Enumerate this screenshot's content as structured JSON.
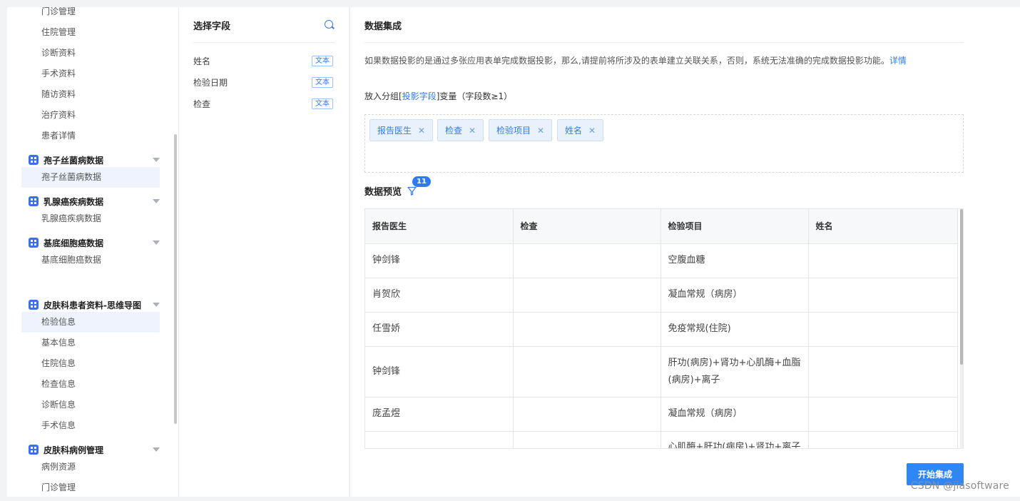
{
  "sidebar": {
    "top_items": [
      "门诊管理",
      "住院管理",
      "诊断资料",
      "手术资料",
      "随访资料",
      "治疗资料",
      "患者详情"
    ],
    "groups": [
      {
        "label": "孢子丝菌病数据",
        "items": [
          "孢子丝菌病数据"
        ]
      },
      {
        "label": "乳腺癌疾病数据",
        "items": [
          "乳腺癌疾病数据"
        ]
      },
      {
        "label": "基底细胞癌数据",
        "items": [
          "基底细胞癌数据"
        ]
      },
      {
        "label": "皮肤科患者资料-思维导图",
        "items": [
          "检验信息",
          "基本信息",
          "住院信息",
          "检查信息",
          "诊断信息",
          "手术信息"
        ]
      },
      {
        "label": "皮肤科病例管理",
        "items": [
          "病例资源",
          "门诊管理"
        ]
      }
    ]
  },
  "fields_panel": {
    "title": "选择字段",
    "fields": [
      {
        "name": "姓名",
        "type": "文本"
      },
      {
        "name": "检验日期",
        "type": "文本"
      },
      {
        "name": "检查",
        "type": "文本"
      }
    ]
  },
  "main": {
    "title": "数据集成",
    "notice": "如果数据投影的是通过多张应用表单完成数据投影，那么,请提前将所涉及的表单建立关联关系，否则，系统无法准确的完成数据投影功能。",
    "notice_link": "详情",
    "group_prefix": "放入分组[",
    "group_link": "投影字段",
    "group_suffix": "]变量（字段数≥1）",
    "chips": [
      "报告医生",
      "检查",
      "检验项目",
      "姓名"
    ],
    "preview_title": "数据预览",
    "filter_count": "11",
    "table": {
      "headers": [
        "报告医生",
        "检查",
        "检验项目",
        "姓名"
      ],
      "rows": [
        [
          "钟剑锋",
          "",
          "空腹血糖",
          ""
        ],
        [
          "肖贺欣",
          "",
          "凝血常规（病房）",
          ""
        ],
        [
          "任雪娇",
          "",
          "免疫常规(住院)",
          ""
        ],
        [
          "钟剑锋",
          "",
          "肝功(病房)+肾功+心肌酶+血脂(病房)+离子",
          ""
        ],
        [
          "庞孟煜",
          "",
          "凝血常规（病房）",
          ""
        ],
        [
          "",
          "",
          "心肌酶+肝功(病房)+肾功+离子",
          ""
        ]
      ]
    },
    "start_button": "开始集成"
  },
  "watermark": "CSDN @jiasoftware",
  "colors": {
    "accent": "#2f7bf0",
    "chip_bg": "#e8f1fc",
    "active_bg": "#eef3fd"
  }
}
